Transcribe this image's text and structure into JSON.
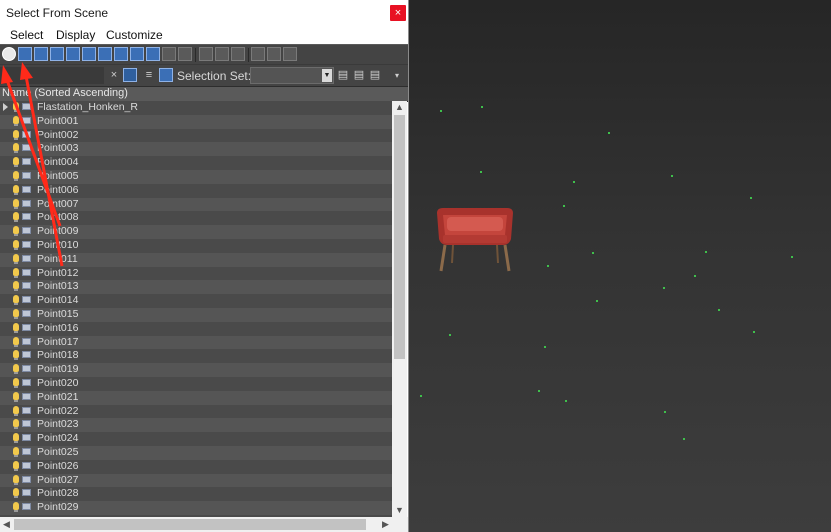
{
  "dialog": {
    "title": "Select From Scene",
    "close_label": "×"
  },
  "menu": [
    "Select",
    "Display",
    "Customize"
  ],
  "filter": {
    "clear_label": "×",
    "selection_set_label": "Selection Set:",
    "selection_set_value": ""
  },
  "list": {
    "header": "Name (Sorted Ascending)",
    "items": [
      "Flastation_Honken_R",
      "Point001",
      "Point002",
      "Point003",
      "Point004",
      "Point005",
      "Point006",
      "Point007",
      "Point008",
      "Point009",
      "Point010",
      "Point011",
      "Point012",
      "Point013",
      "Point014",
      "Point015",
      "Point016",
      "Point017",
      "Point018",
      "Point019",
      "Point020",
      "Point021",
      "Point022",
      "Point023",
      "Point024",
      "Point025",
      "Point026",
      "Point027",
      "Point028",
      "Point029"
    ]
  },
  "colors": {
    "accent": "#3b6fb6",
    "annotation_arrow": "#ff2a1a",
    "close": "#e81123"
  }
}
